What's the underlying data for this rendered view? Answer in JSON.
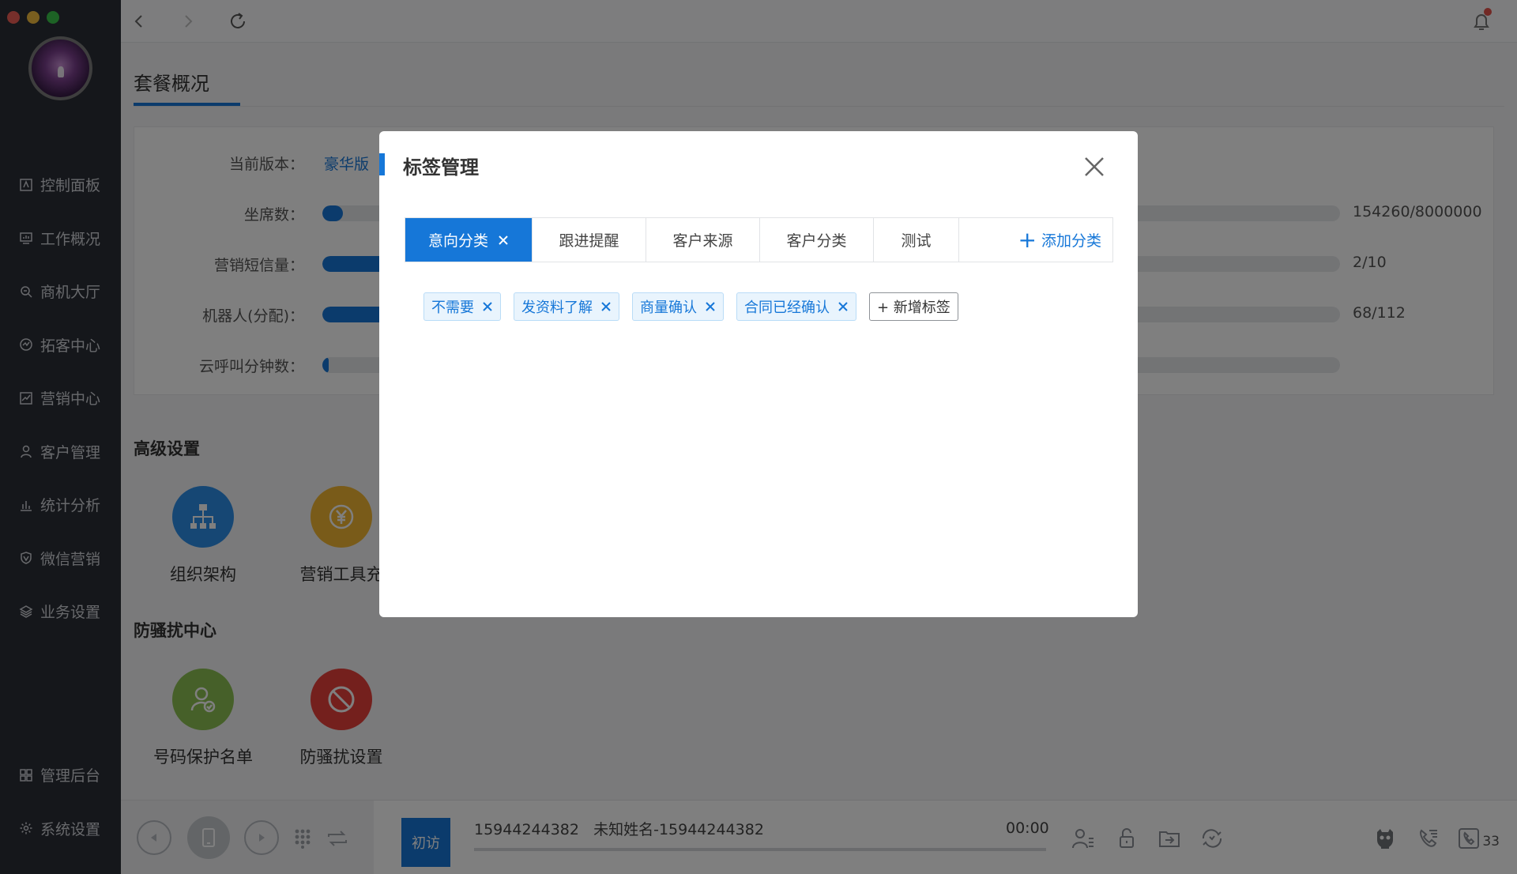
{
  "sidebar": {
    "items": [
      {
        "label": "控制面板",
        "icon": "dashboard-icon"
      },
      {
        "label": "工作概况",
        "icon": "monitor-icon"
      },
      {
        "label": "商机大厅",
        "icon": "opportunity-icon"
      },
      {
        "label": "拓客中心",
        "icon": "expand-icon"
      },
      {
        "label": "营销中心",
        "icon": "trend-icon"
      },
      {
        "label": "客户管理",
        "icon": "customer-icon"
      },
      {
        "label": "统计分析",
        "icon": "bar-chart-icon"
      },
      {
        "label": "微信营销",
        "icon": "shield-v-icon"
      },
      {
        "label": "业务设置",
        "icon": "layers-icon"
      }
    ],
    "bottom_items": [
      {
        "label": "管理后台",
        "icon": "grid-icon"
      },
      {
        "label": "系统设置",
        "icon": "gear-icon"
      }
    ]
  },
  "page": {
    "tab": "套餐概况",
    "rows": [
      {
        "label": "当前版本：",
        "value": "豪华版（"
      },
      {
        "label": "坐席数：",
        "num": "154260/8000000",
        "progress": 0.02
      },
      {
        "label": "营销短信量：",
        "num": "2/10",
        "progress": 0.2
      },
      {
        "label": "机器人(分配)：",
        "num": "68/112",
        "progress": 0.61
      },
      {
        "label": "云呼叫分钟数：",
        "progress": 0.005
      }
    ],
    "advanced": {
      "title": "高级设置",
      "tools": [
        {
          "label": "组织架构",
          "icon": "org-chart-icon",
          "color": "#2d8fe8"
        },
        {
          "label": "营销工具充",
          "icon": "yen-coin-icon",
          "color": "#f2b632"
        }
      ]
    },
    "anti_harass": {
      "title": "防骚扰中心",
      "tools": [
        {
          "label": "号码保护名单",
          "icon": "protected-user-icon",
          "color": "#8cc152"
        },
        {
          "label": "防骚扰设置",
          "icon": "block-icon",
          "color": "#e8413b"
        }
      ]
    }
  },
  "callbar": {
    "first_visit": "初访",
    "info": "15944244382   未知姓名-15944244382",
    "time": "00:00",
    "count": "33"
  },
  "modal": {
    "title": "标签管理",
    "categories": [
      "意向分类",
      "跟进提醒",
      "客户来源",
      "客户分类",
      "测试"
    ],
    "active_category": "意向分类",
    "add_category": "添加分类",
    "tags": [
      "不需要",
      "发资料了解",
      "商量确认",
      "合同已经确认"
    ],
    "new_tag": "+ 新增标签"
  },
  "colors": {
    "accent": "#1677d8",
    "sidebar_bg": "#2a2e36"
  }
}
